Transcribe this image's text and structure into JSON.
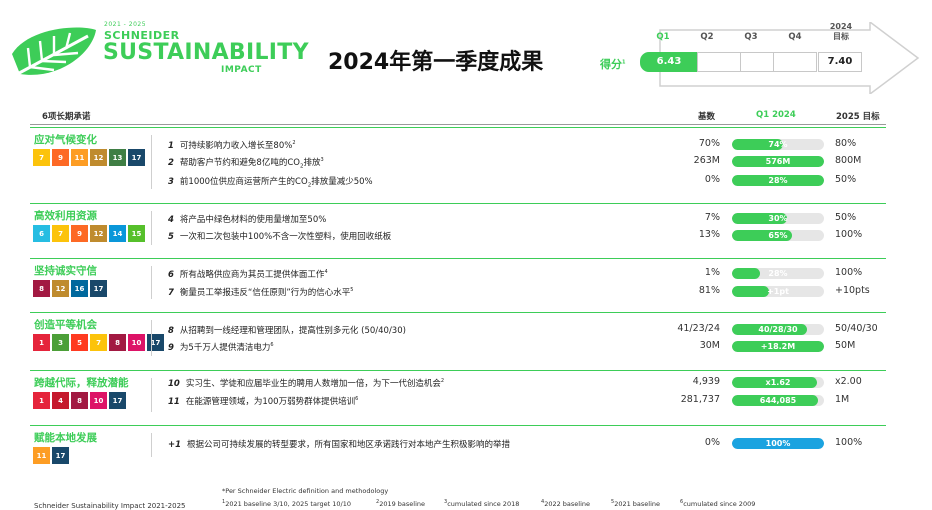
{
  "logo": {
    "years": "2021 - 2025",
    "brand": "SCHNEIDER",
    "sustainability": "SUSTAINABILITY",
    "impact": "IMPACT"
  },
  "page_title": "2024年第一季度成果",
  "score": {
    "label": "得分",
    "label_sup": "1",
    "quarters": [
      "Q1",
      "Q2",
      "Q3",
      "Q4"
    ],
    "target_label_line1": "2024",
    "target_label_line2": "目标",
    "q1_value": "6.43",
    "q1_progress": 0.87,
    "target_value": "7.40"
  },
  "table_header": {
    "commitments": "6项长期承诺",
    "baseline": "基数",
    "q1": "Q1 2024",
    "target": "2025 目标"
  },
  "colors": {
    "accent": "#3dcd58",
    "blue": "#1ba3e0",
    "track": "#e6e6e6"
  },
  "sections": [
    {
      "title": "应对气候变化",
      "sdgs": [
        {
          "n": "7",
          "color": "#fcc30b",
          "icon": "sun-icon"
        },
        {
          "n": "9",
          "color": "#fd6925",
          "icon": "cube-icon"
        },
        {
          "n": "11",
          "color": "#fd9d24",
          "icon": "city-icon"
        },
        {
          "n": "12",
          "color": "#bf8b2e",
          "icon": "infinity-icon"
        },
        {
          "n": "13",
          "color": "#3f7e44",
          "icon": "eye-icon"
        },
        {
          "n": "17",
          "color": "#19486a",
          "icon": "flower-icon"
        }
      ],
      "rows": [
        {
          "num": "1",
          "text": "可持续影响力收入增长至80%",
          "sup": "2",
          "baseline": "70%",
          "value": "74%",
          "fill": 0.55,
          "target": "80%"
        },
        {
          "num": "2",
          "text_pre": "帮助客户节约和避免8亿吨的CO",
          "text_sub": "2",
          "text_post": "排放",
          "sup": "3",
          "baseline": "263M",
          "value": "576M",
          "fill": 1.0,
          "target": "800M"
        },
        {
          "num": "3",
          "text_pre": "前1000位供应商运营所产生的CO",
          "text_sub": "2",
          "text_post": "排放量减少50%",
          "sup": "",
          "baseline": "0%",
          "value": "28%",
          "fill": 1.0,
          "target": "50%"
        }
      ]
    },
    {
      "title": "高效利用资源",
      "sdgs": [
        {
          "n": "6",
          "color": "#26bde2",
          "icon": "drop-icon"
        },
        {
          "n": "7",
          "color": "#fcc30b",
          "icon": "sun-icon"
        },
        {
          "n": "9",
          "color": "#fd6925",
          "icon": "cube-icon"
        },
        {
          "n": "12",
          "color": "#bf8b2e",
          "icon": "infinity-icon"
        },
        {
          "n": "14",
          "color": "#0a97d9",
          "icon": "fish-icon"
        },
        {
          "n": "15",
          "color": "#56c02b",
          "icon": "tree-icon"
        }
      ],
      "rows": [
        {
          "num": "4",
          "text": "将产品中绿色材料的使用量增加至50%",
          "sup": "",
          "baseline": "7%",
          "value": "30%",
          "fill": 0.6,
          "target": "50%"
        },
        {
          "num": "5",
          "text": "一次和二次包装中100%不含一次性塑料，使用回收纸板",
          "sup": "",
          "baseline": "13%",
          "value": "65%",
          "fill": 0.65,
          "target": "100%"
        }
      ]
    },
    {
      "title": "坚持诚实守信",
      "sdgs": [
        {
          "n": "8",
          "color": "#a21942",
          "icon": "chart-icon"
        },
        {
          "n": "12",
          "color": "#bf8b2e",
          "icon": "infinity-icon"
        },
        {
          "n": "16",
          "color": "#00689d",
          "icon": "dove-icon"
        },
        {
          "n": "17",
          "color": "#19486a",
          "icon": "flower-icon"
        }
      ],
      "rows": [
        {
          "num": "6",
          "text": "所有战略供应商为其员工提供体面工作",
          "sup": "4",
          "baseline": "1%",
          "value": "28%",
          "fill": 0.3,
          "target": "100%"
        },
        {
          "num": "7",
          "text": "衡量员工举报违反“信任原则”行为的信心水平",
          "sup": "5",
          "baseline": "81%",
          "value": "+1pt",
          "fill": 0.4,
          "target": "+10pts"
        }
      ]
    },
    {
      "title": "创造平等机会",
      "sdgs": [
        {
          "n": "1",
          "color": "#e5243b",
          "icon": "people-icon"
        },
        {
          "n": "3",
          "color": "#4c9f38",
          "icon": "heart-icon"
        },
        {
          "n": "5",
          "color": "#ff3a21",
          "icon": "gender-icon"
        },
        {
          "n": "7",
          "color": "#fcc30b",
          "icon": "sun-icon"
        },
        {
          "n": "8",
          "color": "#a21942",
          "icon": "chart-icon"
        },
        {
          "n": "10",
          "color": "#dd1367",
          "icon": "equal-icon"
        },
        {
          "n": "17",
          "color": "#19486a",
          "icon": "flower-icon"
        }
      ],
      "rows": [
        {
          "num": "8",
          "text": "从招聘到一线经理和管理团队，提高性别多元化 (50/40/30)",
          "sup": "",
          "baseline": "41/23/24",
          "value": "40/28/30",
          "fill": 0.82,
          "target": "50/40/30"
        },
        {
          "num": "9",
          "text": "为5千万人提供清洁电力",
          "sup": "6",
          "baseline": "30M",
          "value": "+18.2M",
          "fill": 1.0,
          "target": "50M"
        }
      ]
    },
    {
      "title": "跨越代际，释放潜能",
      "sdgs": [
        {
          "n": "1",
          "color": "#e5243b",
          "icon": "people-icon"
        },
        {
          "n": "4",
          "color": "#c5192d",
          "icon": "book-icon"
        },
        {
          "n": "8",
          "color": "#a21942",
          "icon": "chart-icon"
        },
        {
          "n": "10",
          "color": "#dd1367",
          "icon": "equal-icon"
        },
        {
          "n": "17",
          "color": "#19486a",
          "icon": "flower-icon"
        }
      ],
      "rows": [
        {
          "num": "10",
          "text": "实习生、学徒和应届毕业生的聘用人数增加一倍，为下一代创造机会",
          "sup": "2",
          "baseline": "4,939",
          "value": "x1.62",
          "fill": 0.92,
          "target": "x2.00"
        },
        {
          "num": "11",
          "text": "在能源管理领域，为100万弱势群体提供培训",
          "sup": "6",
          "baseline": "281,737",
          "value": "644,085",
          "fill": 0.94,
          "target": "1M"
        }
      ]
    },
    {
      "title": "赋能本地发展",
      "sdgs": [
        {
          "n": "11",
          "color": "#fd9d24",
          "icon": "city-icon"
        },
        {
          "n": "17",
          "color": "#19486a",
          "icon": "flower-icon"
        }
      ],
      "rows": [
        {
          "num": "+1",
          "text": "根据公司可持续发展的转型要求，所有国家和地区承诺践行对本地产生积极影响的举措",
          "sup": "",
          "baseline": "0%",
          "value": "100%",
          "fill": 1.0,
          "target": "100%",
          "blue": true
        }
      ]
    }
  ],
  "footer": {
    "note": "*Per Schneider Electric definition and methodology",
    "notes": [
      {
        "sup": "1",
        "text": "2021 baseline 3/10, 2025 target 10/10"
      },
      {
        "sup": "2",
        "text": "2019 baseline"
      },
      {
        "sup": "3",
        "text": "cumulated since 2018"
      },
      {
        "sup": "4",
        "text": "2022 baseline"
      },
      {
        "sup": "5",
        "text": "2021 baseline"
      },
      {
        "sup": "6",
        "text": "cumulated since 2009"
      }
    ],
    "left": "Schneider Sustainability Impact 2021-2025"
  }
}
